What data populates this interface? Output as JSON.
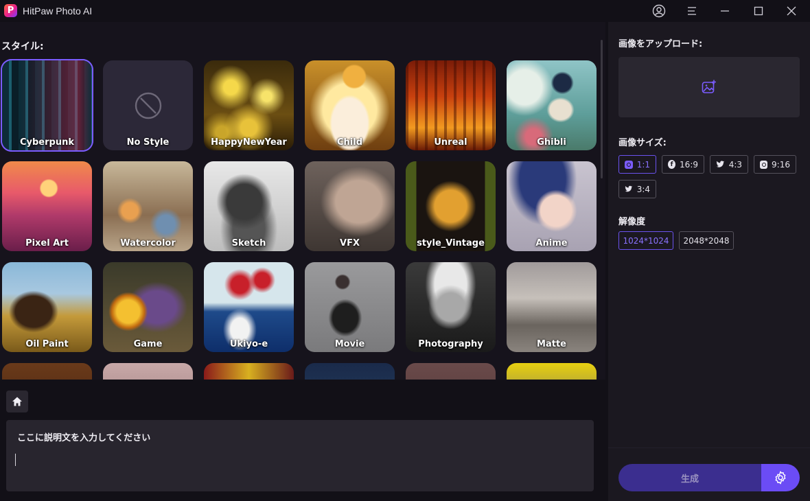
{
  "app": {
    "title": "HitPaw Photo AI",
    "logo_letter": "P"
  },
  "titlebar": {
    "icons": [
      "account-icon",
      "menu-icon",
      "minimize-icon",
      "maximize-icon",
      "close-icon"
    ]
  },
  "styles_section": {
    "label": "スタイル:"
  },
  "styles": [
    {
      "label": "Cyberpunk",
      "selected": true
    },
    {
      "label": "No Style"
    },
    {
      "label": "HappyNewYear"
    },
    {
      "label": "Child"
    },
    {
      "label": "Unreal"
    },
    {
      "label": "Ghibli"
    },
    {
      "label": "Pixel Art"
    },
    {
      "label": "Watercolor"
    },
    {
      "label": "Sketch"
    },
    {
      "label": "VFX"
    },
    {
      "label": "style_Vintage"
    },
    {
      "label": "Anime"
    },
    {
      "label": "Oil Paint"
    },
    {
      "label": "Game"
    },
    {
      "label": "Ukiyo-e"
    },
    {
      "label": "Movie"
    },
    {
      "label": "Photography"
    },
    {
      "label": "Matte"
    },
    {
      "label": ""
    },
    {
      "label": ""
    },
    {
      "label": ""
    },
    {
      "label": ""
    },
    {
      "label": ""
    },
    {
      "label": ""
    }
  ],
  "prompt": {
    "placeholder": "ここに説明文を入力してください"
  },
  "right_panel": {
    "upload_label": "画像をアップロード:",
    "size_label": "画像サイズ:",
    "sizes": [
      {
        "label": "1:1",
        "icon": "instagram-icon",
        "active": true
      },
      {
        "label": "16:9",
        "icon": "facebook-icon"
      },
      {
        "label": "4:3",
        "icon": "twitter-icon"
      },
      {
        "label": "9:16",
        "icon": "instagram-icon"
      },
      {
        "label": "3:4",
        "icon": "twitter-icon"
      }
    ],
    "resolution_label": "解像度",
    "resolutions": [
      {
        "label": "1024*1024",
        "active": true
      },
      {
        "label": "2048*2048"
      }
    ],
    "generate_label": "生成"
  },
  "colors": {
    "accent": "#7b5cff",
    "generate_bg": "#3b2e8f",
    "settings_bg": "#6b4cf5"
  }
}
